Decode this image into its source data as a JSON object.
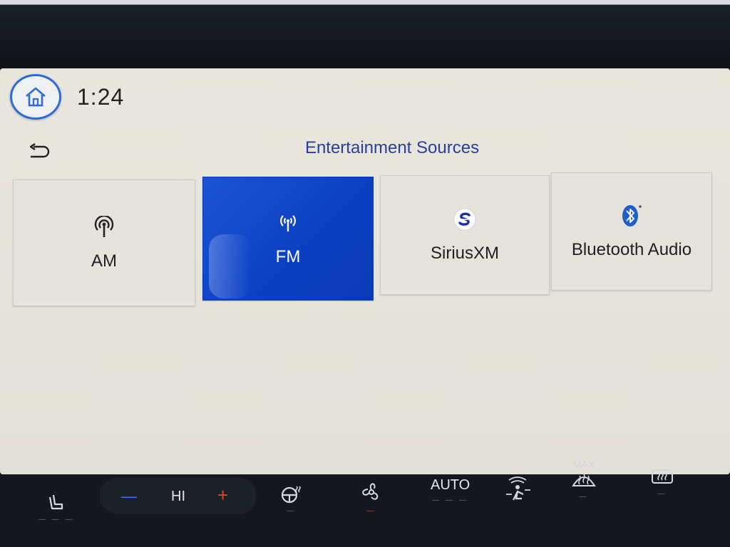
{
  "status_bar": {
    "clock": "1:24"
  },
  "header": {
    "title": "Entertainment Sources"
  },
  "sources": [
    {
      "label": "AM",
      "icon": "antenna-icon",
      "active": false
    },
    {
      "label": "FM",
      "icon": "broadcast-antenna-icon",
      "active": true
    },
    {
      "label": "SiriusXM",
      "icon": "siriusxm-logo-icon",
      "active": false
    },
    {
      "label": "Bluetooth Audio",
      "icon": "bluetooth-icon",
      "active": false
    }
  ],
  "climate": {
    "fan_label": "HI",
    "minus_label": "—",
    "plus_label": "+",
    "auto_label": "AUTO",
    "max_label": "MAX"
  },
  "colors": {
    "accent": "#1b54d6",
    "title": "#2a3f9a",
    "home_ring": "#2d6bd6",
    "plus": "#e0442a",
    "minus": "#3c79e6"
  }
}
